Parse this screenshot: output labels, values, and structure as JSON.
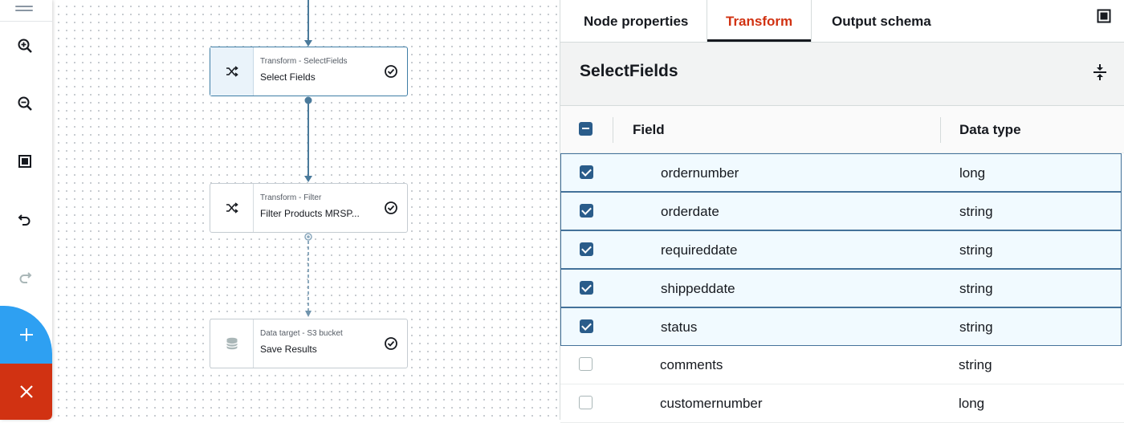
{
  "toolbar": {
    "tools": [
      {
        "icon": "zoom-in-icon"
      },
      {
        "icon": "zoom-out-icon"
      },
      {
        "icon": "fit-view-icon"
      },
      {
        "icon": "undo-icon"
      },
      {
        "icon": "redo-icon"
      }
    ],
    "add_icon": "plus-icon",
    "close_icon": "close-icon"
  },
  "nodes": [
    {
      "kind": "Transform - SelectFields",
      "title": "Select Fields",
      "icon": "shuffle-icon",
      "status_icon": "check-circle-icon",
      "selected": true
    },
    {
      "kind": "Transform - Filter",
      "title": "Filter Products MRSP...",
      "icon": "shuffle-icon",
      "status_icon": "check-circle-icon",
      "selected": false
    },
    {
      "kind": "Data target - S3 bucket",
      "title": "Save Results",
      "icon": "database-icon",
      "status_icon": "check-circle-icon",
      "selected": false
    }
  ],
  "panel": {
    "tabs": [
      {
        "label": "Node properties",
        "active": false
      },
      {
        "label": "Transform",
        "active": true
      },
      {
        "label": "Output schema",
        "active": false
      }
    ],
    "section_title": "SelectFields",
    "columns": {
      "field": "Field",
      "type": "Data type"
    },
    "rows": [
      {
        "field": "ordernumber",
        "type": "long",
        "checked": true
      },
      {
        "field": "orderdate",
        "type": "string",
        "checked": true
      },
      {
        "field": "requireddate",
        "type": "string",
        "checked": true
      },
      {
        "field": "shippeddate",
        "type": "string",
        "checked": true
      },
      {
        "field": "status",
        "type": "string",
        "checked": true
      },
      {
        "field": "comments",
        "type": "string",
        "checked": false
      },
      {
        "field": "customernumber",
        "type": "long",
        "checked": false
      }
    ]
  },
  "colors": {
    "accent_active_tab": "#d13212",
    "checkbox_checked": "#2a5c8a",
    "selected_row_border": "#44729a",
    "add_button": "#2ea0f2",
    "close_button": "#d13212",
    "edge": "#4a7a9b"
  }
}
